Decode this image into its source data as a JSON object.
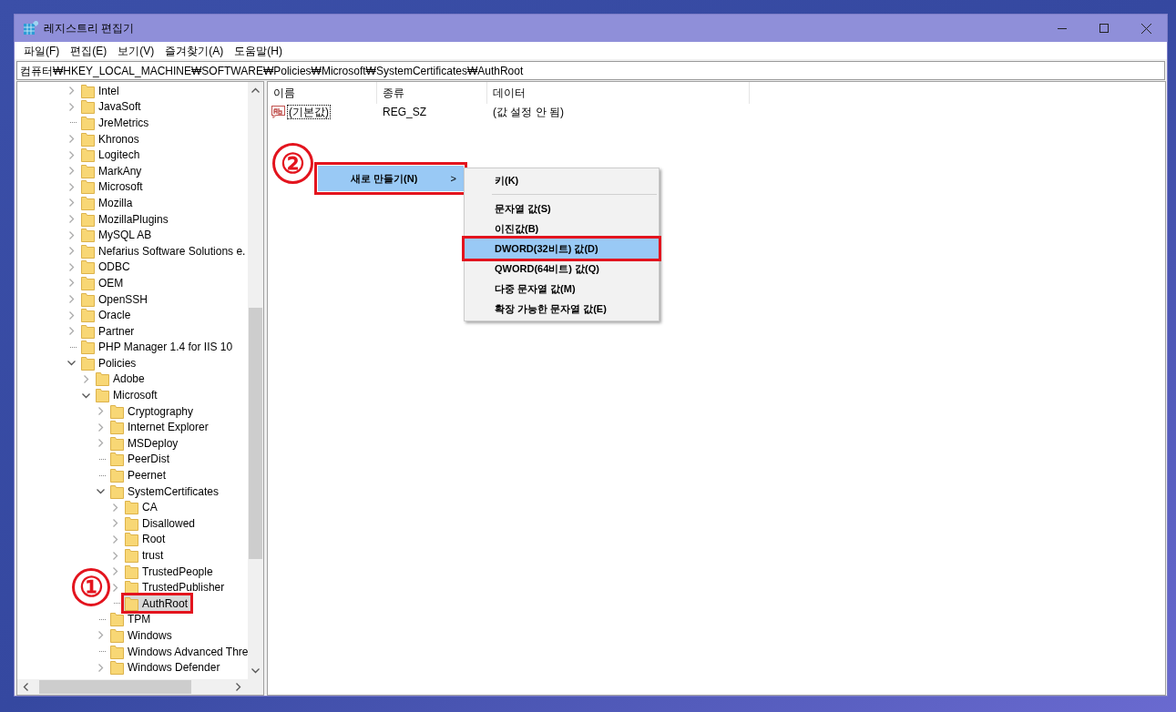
{
  "window": {
    "title": "레지스트리 편집기"
  },
  "menu_bar": [
    "파일(F)",
    "편집(E)",
    "보기(V)",
    "즐겨찾기(A)",
    "도움말(H)"
  ],
  "address": "컴퓨터₩HKEY_LOCAL_MACHINE₩SOFTWARE₩Policies₩Microsoft₩SystemCertificates₩AuthRoot",
  "tree": [
    {
      "label": "Intel",
      "kind": "branch",
      "expanded": false,
      "selected": false,
      "outlined": false
    },
    {
      "label": "JavaSoft",
      "kind": "branch",
      "expanded": false,
      "selected": false,
      "outlined": false
    },
    {
      "label": "JreMetrics",
      "kind": "leaf",
      "selected": false,
      "outlined": false
    },
    {
      "label": "Khronos",
      "kind": "branch",
      "expanded": false,
      "selected": false,
      "outlined": false
    },
    {
      "label": "Logitech",
      "kind": "branch",
      "expanded": false,
      "selected": false,
      "outlined": false
    },
    {
      "label": "MarkAny",
      "kind": "branch",
      "expanded": false,
      "selected": false,
      "outlined": false
    },
    {
      "label": "Microsoft",
      "kind": "branch",
      "expanded": false,
      "selected": false,
      "outlined": false
    },
    {
      "label": "Mozilla",
      "kind": "branch",
      "expanded": false,
      "selected": false,
      "outlined": false
    },
    {
      "label": "MozillaPlugins",
      "kind": "branch",
      "expanded": false,
      "selected": false,
      "outlined": false
    },
    {
      "label": "MySQL AB",
      "kind": "branch",
      "expanded": false,
      "selected": false,
      "outlined": false
    },
    {
      "label": "Nefarius Software Solutions e.",
      "kind": "branch",
      "expanded": false,
      "selected": false,
      "outlined": false
    },
    {
      "label": "ODBC",
      "kind": "branch",
      "expanded": false,
      "selected": false,
      "outlined": false
    },
    {
      "label": "OEM",
      "kind": "branch",
      "expanded": false,
      "selected": false,
      "outlined": false
    },
    {
      "label": "OpenSSH",
      "kind": "branch",
      "expanded": false,
      "selected": false,
      "outlined": false
    },
    {
      "label": "Oracle",
      "kind": "branch",
      "expanded": false,
      "selected": false,
      "outlined": false
    },
    {
      "label": "Partner",
      "kind": "branch",
      "expanded": false,
      "selected": false,
      "outlined": false
    },
    {
      "label": "PHP Manager 1.4 for IIS 10",
      "kind": "leaf",
      "selected": false,
      "outlined": false
    },
    {
      "label": "Policies",
      "kind": "branch",
      "expanded": true,
      "selected": false,
      "outlined": false,
      "children": [
        {
          "label": "Adobe",
          "kind": "branch",
          "expanded": false,
          "selected": false,
          "outlined": false
        },
        {
          "label": "Microsoft",
          "kind": "branch",
          "expanded": true,
          "selected": false,
          "outlined": false,
          "children": [
            {
              "label": "Cryptography",
              "kind": "branch",
              "expanded": false,
              "selected": false,
              "outlined": false
            },
            {
              "label": "Internet Explorer",
              "kind": "branch",
              "expanded": false,
              "selected": false,
              "outlined": false
            },
            {
              "label": "MSDeploy",
              "kind": "branch",
              "expanded": false,
              "selected": false,
              "outlined": false
            },
            {
              "label": "PeerDist",
              "kind": "leaf",
              "selected": false,
              "outlined": false
            },
            {
              "label": "Peernet",
              "kind": "leaf",
              "selected": false,
              "outlined": false
            },
            {
              "label": "SystemCertificates",
              "kind": "branch",
              "expanded": true,
              "selected": false,
              "outlined": false,
              "children": [
                {
                  "label": "CA",
                  "kind": "branch",
                  "expanded": false,
                  "selected": false,
                  "outlined": false
                },
                {
                  "label": "Disallowed",
                  "kind": "branch",
                  "expanded": false,
                  "selected": false,
                  "outlined": false
                },
                {
                  "label": "Root",
                  "kind": "branch",
                  "expanded": false,
                  "selected": false,
                  "outlined": false
                },
                {
                  "label": "trust",
                  "kind": "branch",
                  "expanded": false,
                  "selected": false,
                  "outlined": false
                },
                {
                  "label": "TrustedPeople",
                  "kind": "branch",
                  "expanded": false,
                  "selected": false,
                  "outlined": false
                },
                {
                  "label": "TrustedPublisher",
                  "kind": "branch",
                  "expanded": false,
                  "selected": false,
                  "outlined": false
                },
                {
                  "label": "AuthRoot",
                  "kind": "leaf",
                  "selected": true,
                  "outlined": true
                }
              ]
            },
            {
              "label": "TPM",
              "kind": "leaf",
              "selected": false,
              "outlined": false
            },
            {
              "label": "Windows",
              "kind": "branch",
              "expanded": false,
              "selected": false,
              "outlined": false
            },
            {
              "label": "Windows Advanced Thre",
              "kind": "leaf",
              "selected": false,
              "outlined": false
            },
            {
              "label": "Windows Defender",
              "kind": "branch",
              "expanded": false,
              "selected": false,
              "outlined": false
            }
          ]
        }
      ]
    }
  ],
  "list": {
    "columns": [
      "이름",
      "종류",
      "데이터"
    ],
    "rows": [
      {
        "name": "(기본값)",
        "type": "REG_SZ",
        "data": "(값 설정 안 됨)"
      }
    ]
  },
  "context_menu": {
    "items": [
      {
        "label": "새로 만들기(N)",
        "arrow": ">",
        "selected": true,
        "outlined": true
      }
    ]
  },
  "submenu": {
    "items": [
      {
        "kind": "item",
        "label": "키(K)",
        "selected": false,
        "outlined": false
      },
      {
        "kind": "separator"
      },
      {
        "kind": "item",
        "label": "문자열 값(S)",
        "selected": false,
        "outlined": false
      },
      {
        "kind": "item",
        "label": "이진값(B)",
        "selected": false,
        "outlined": false
      },
      {
        "kind": "item",
        "label": "DWORD(32비트) 값(D)",
        "selected": true,
        "outlined": true
      },
      {
        "kind": "item",
        "label": "QWORD(64비트) 값(Q)",
        "selected": false,
        "outlined": false
      },
      {
        "kind": "item",
        "label": "다중 문자열 값(M)",
        "selected": false,
        "outlined": false
      },
      {
        "kind": "item",
        "label": "확장 가능한 문자열 값(E)",
        "selected": false,
        "outlined": false
      }
    ]
  },
  "annotations": [
    {
      "label": "①"
    },
    {
      "label": "②"
    }
  ]
}
